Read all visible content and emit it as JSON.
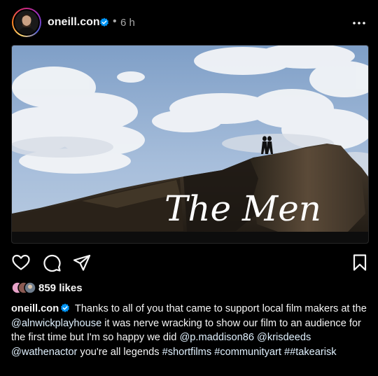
{
  "post": {
    "username": "oneill.con",
    "dot": "•",
    "time": "6 h",
    "image_title_text": "The Men",
    "likes": "859 likes",
    "caption": {
      "username": "oneill.con",
      "text_1": "Thanks to all of you that came to support local film makers at the",
      "mention_1": "@alnwickplayhouse",
      "text_2": "it was nerve wracking to show our film to an audience for the first time but I'm so happy we did",
      "mention_2": "@p.maddison86",
      "mention_3": "@krisdeeds",
      "mention_4": "@wathenactor",
      "text_3": "you're all legends",
      "hashtag_1": "#shortfilms",
      "hashtag_2": "#communityart",
      "hashtag_3": "##takearisk"
    }
  },
  "colors": {
    "background": "#000000",
    "text": "#f5f5f5",
    "secondary_text": "#a8a8a8",
    "verified": "#0095f6",
    "link": "#e0f1ff"
  },
  "icons": {
    "like": "heart-icon",
    "comment": "comment-icon",
    "share": "share-icon",
    "save": "bookmark-icon",
    "more": "more-options-icon"
  }
}
